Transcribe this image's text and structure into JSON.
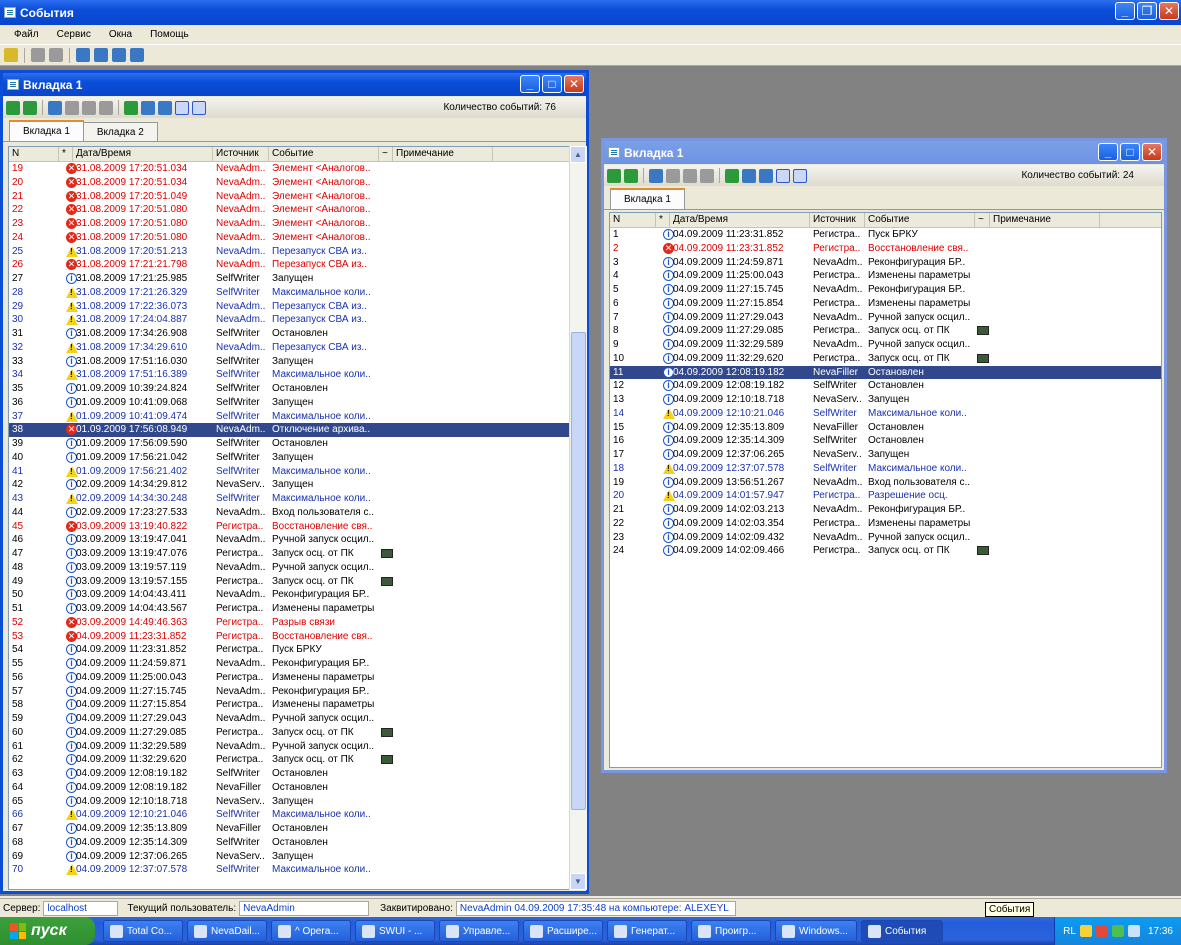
{
  "app": {
    "title": "События"
  },
  "menu": [
    "Файл",
    "Сервис",
    "Окна",
    "Помощь"
  ],
  "left_window": {
    "title": "Вкладка 1",
    "events_count_label": "Количество событий:",
    "events_count": "76",
    "tabs": [
      "Вкладка 1",
      "Вкладка 2"
    ],
    "columns": [
      "N",
      "*",
      "Дата/Время",
      "Источник",
      "Событие",
      "~",
      "Примечание"
    ],
    "rows": [
      {
        "n": "19",
        "sev": "err",
        "dt": "31.08.2009 17:20:51.034",
        "src": "NevaAdm..",
        "ev": "Элемент <Аналогов..",
        "cam": false,
        "color": "red"
      },
      {
        "n": "20",
        "sev": "err",
        "dt": "31.08.2009 17:20:51.034",
        "src": "NevaAdm..",
        "ev": "Элемент <Аналогов..",
        "cam": false,
        "color": "red"
      },
      {
        "n": "21",
        "sev": "err",
        "dt": "31.08.2009 17:20:51.049",
        "src": "NevaAdm..",
        "ev": "Элемент <Аналогов..",
        "cam": false,
        "color": "red"
      },
      {
        "n": "22",
        "sev": "err",
        "dt": "31.08.2009 17:20:51.080",
        "src": "NevaAdm..",
        "ev": "Элемент <Аналогов..",
        "cam": false,
        "color": "red"
      },
      {
        "n": "23",
        "sev": "err",
        "dt": "31.08.2009 17:20:51.080",
        "src": "NevaAdm..",
        "ev": "Элемент <Аналогов..",
        "cam": false,
        "color": "red"
      },
      {
        "n": "24",
        "sev": "err",
        "dt": "31.08.2009 17:20:51.080",
        "src": "NevaAdm..",
        "ev": "Элемент <Аналогов..",
        "cam": false,
        "color": "red"
      },
      {
        "n": "25",
        "sev": "warn",
        "dt": "31.08.2009 17:20:51.213",
        "src": "NevaAdm..",
        "ev": "Перезапуск СВА из..",
        "cam": false,
        "color": "blu"
      },
      {
        "n": "26",
        "sev": "err",
        "dt": "31.08.2009 17:21:21.798",
        "src": "NevaAdm..",
        "ev": "Перезапуск СВА из..",
        "cam": false,
        "color": "red"
      },
      {
        "n": "27",
        "sev": "info",
        "dt": "31.08.2009 17:21:25.985",
        "src": "SelfWriter",
        "ev": "Запущен",
        "cam": false,
        "color": ""
      },
      {
        "n": "28",
        "sev": "warn",
        "dt": "31.08.2009 17:21:26.329",
        "src": "SelfWriter",
        "ev": "Максимальное коли..",
        "cam": false,
        "color": "blu"
      },
      {
        "n": "29",
        "sev": "warn",
        "dt": "31.08.2009 17:22:36.073",
        "src": "NevaAdm..",
        "ev": "Перезапуск СВА из..",
        "cam": false,
        "color": "blu"
      },
      {
        "n": "30",
        "sev": "warn",
        "dt": "31.08.2009 17:24:04.887",
        "src": "NevaAdm..",
        "ev": "Перезапуск СВА из..",
        "cam": false,
        "color": "blu"
      },
      {
        "n": "31",
        "sev": "info",
        "dt": "31.08.2009 17:34:26.908",
        "src": "SelfWriter",
        "ev": "Остановлен",
        "cam": false,
        "color": ""
      },
      {
        "n": "32",
        "sev": "warn",
        "dt": "31.08.2009 17:34:29.610",
        "src": "NevaAdm..",
        "ev": "Перезапуск СВА из..",
        "cam": false,
        "color": "blu"
      },
      {
        "n": "33",
        "sev": "info",
        "dt": "31.08.2009 17:51:16.030",
        "src": "SelfWriter",
        "ev": "Запущен",
        "cam": false,
        "color": ""
      },
      {
        "n": "34",
        "sev": "warn",
        "dt": "31.08.2009 17:51:16.389",
        "src": "SelfWriter",
        "ev": "Максимальное коли..",
        "cam": false,
        "color": "blu"
      },
      {
        "n": "35",
        "sev": "info",
        "dt": "01.09.2009 10:39:24.824",
        "src": "SelfWriter",
        "ev": "Остановлен",
        "cam": false,
        "color": ""
      },
      {
        "n": "36",
        "sev": "info",
        "dt": "01.09.2009 10:41:09.068",
        "src": "SelfWriter",
        "ev": "Запущен",
        "cam": false,
        "color": ""
      },
      {
        "n": "37",
        "sev": "warn",
        "dt": "01.09.2009 10:41:09.474",
        "src": "SelfWriter",
        "ev": "Максимальное коли..",
        "cam": false,
        "color": "blu"
      },
      {
        "n": "38",
        "sev": "err",
        "dt": "01.09.2009 17:56:08.949",
        "src": "NevaAdm..",
        "ev": "Отключение архива..",
        "cam": false,
        "color": "hl"
      },
      {
        "n": "39",
        "sev": "info",
        "dt": "01.09.2009 17:56:09.590",
        "src": "SelfWriter",
        "ev": "Остановлен",
        "cam": false,
        "color": ""
      },
      {
        "n": "40",
        "sev": "info",
        "dt": "01.09.2009 17:56:21.042",
        "src": "SelfWriter",
        "ev": "Запущен",
        "cam": false,
        "color": ""
      },
      {
        "n": "41",
        "sev": "warn",
        "dt": "01.09.2009 17:56:21.402",
        "src": "SelfWriter",
        "ev": "Максимальное коли..",
        "cam": false,
        "color": "blu"
      },
      {
        "n": "42",
        "sev": "info",
        "dt": "02.09.2009 14:34:29.812",
        "src": "NevaServ..",
        "ev": "Запущен",
        "cam": false,
        "color": ""
      },
      {
        "n": "43",
        "sev": "warn",
        "dt": "02.09.2009 14:34:30.248",
        "src": "SelfWriter",
        "ev": "Максимальное коли..",
        "cam": false,
        "color": "blu"
      },
      {
        "n": "44",
        "sev": "info",
        "dt": "02.09.2009 17:23:27.533",
        "src": "NevaAdm..",
        "ev": "Вход пользователя с..",
        "cam": false,
        "color": ""
      },
      {
        "n": "45",
        "sev": "err",
        "dt": "03.09.2009 13:19:40.822",
        "src": "Регистра..",
        "ev": "Восстановление свя..",
        "cam": false,
        "color": "red"
      },
      {
        "n": "46",
        "sev": "info",
        "dt": "03.09.2009 13:19:47.041",
        "src": "NevaAdm..",
        "ev": "Ручной запуск осцил..",
        "cam": false,
        "color": ""
      },
      {
        "n": "47",
        "sev": "info",
        "dt": "03.09.2009 13:19:47.076",
        "src": "Регистра..",
        "ev": "Запуск осц. от ПК",
        "cam": true,
        "color": ""
      },
      {
        "n": "48",
        "sev": "info",
        "dt": "03.09.2009 13:19:57.119",
        "src": "NevaAdm..",
        "ev": "Ручной запуск осцил..",
        "cam": false,
        "color": ""
      },
      {
        "n": "49",
        "sev": "info",
        "dt": "03.09.2009 13:19:57.155",
        "src": "Регистра..",
        "ev": "Запуск осц. от ПК",
        "cam": true,
        "color": ""
      },
      {
        "n": "50",
        "sev": "info",
        "dt": "03.09.2009 14:04:43.411",
        "src": "NevaAdm..",
        "ev": "Реконфигурация БР..",
        "cam": false,
        "color": ""
      },
      {
        "n": "51",
        "sev": "info",
        "dt": "03.09.2009 14:04:43.567",
        "src": "Регистра..",
        "ev": "Изменены параметры",
        "cam": false,
        "color": ""
      },
      {
        "n": "52",
        "sev": "err",
        "dt": "03.09.2009 14:49:46.363",
        "src": "Регистра..",
        "ev": "Разрыв связи",
        "cam": false,
        "color": "red"
      },
      {
        "n": "53",
        "sev": "err",
        "dt": "04.09.2009 11:23:31.852",
        "src": "Регистра..",
        "ev": "Восстановление свя..",
        "cam": false,
        "color": "red"
      },
      {
        "n": "54",
        "sev": "info",
        "dt": "04.09.2009 11:23:31.852",
        "src": "Регистра..",
        "ev": "Пуск БРКУ",
        "cam": false,
        "color": ""
      },
      {
        "n": "55",
        "sev": "info",
        "dt": "04.09.2009 11:24:59.871",
        "src": "NevaAdm..",
        "ev": "Реконфигурация БР..",
        "cam": false,
        "color": ""
      },
      {
        "n": "56",
        "sev": "info",
        "dt": "04.09.2009 11:25:00.043",
        "src": "Регистра..",
        "ev": "Изменены параметры",
        "cam": false,
        "color": ""
      },
      {
        "n": "57",
        "sev": "info",
        "dt": "04.09.2009 11:27:15.745",
        "src": "NevaAdm..",
        "ev": "Реконфигурация БР..",
        "cam": false,
        "color": ""
      },
      {
        "n": "58",
        "sev": "info",
        "dt": "04.09.2009 11:27:15.854",
        "src": "Регистра..",
        "ev": "Изменены параметры",
        "cam": false,
        "color": ""
      },
      {
        "n": "59",
        "sev": "info",
        "dt": "04.09.2009 11:27:29.043",
        "src": "NevaAdm..",
        "ev": "Ручной запуск осцил..",
        "cam": false,
        "color": ""
      },
      {
        "n": "60",
        "sev": "info",
        "dt": "04.09.2009 11:27:29.085",
        "src": "Регистра..",
        "ev": "Запуск осц. от ПК",
        "cam": true,
        "color": ""
      },
      {
        "n": "61",
        "sev": "info",
        "dt": "04.09.2009 11:32:29.589",
        "src": "NevaAdm..",
        "ev": "Ручной запуск осцил..",
        "cam": false,
        "color": ""
      },
      {
        "n": "62",
        "sev": "info",
        "dt": "04.09.2009 11:32:29.620",
        "src": "Регистра..",
        "ev": "Запуск осц. от ПК",
        "cam": true,
        "color": ""
      },
      {
        "n": "63",
        "sev": "info",
        "dt": "04.09.2009 12:08:19.182",
        "src": "SelfWriter",
        "ev": "Остановлен",
        "cam": false,
        "color": ""
      },
      {
        "n": "64",
        "sev": "info",
        "dt": "04.09.2009 12:08:19.182",
        "src": "NevaFiller",
        "ev": "Остановлен",
        "cam": false,
        "color": ""
      },
      {
        "n": "65",
        "sev": "info",
        "dt": "04.09.2009 12:10:18.718",
        "src": "NevaServ..",
        "ev": "Запущен",
        "cam": false,
        "color": ""
      },
      {
        "n": "66",
        "sev": "warn",
        "dt": "04.09.2009 12:10:21.046",
        "src": "SelfWriter",
        "ev": "Максимальное коли..",
        "cam": false,
        "color": "blu"
      },
      {
        "n": "67",
        "sev": "info",
        "dt": "04.09.2009 12:35:13.809",
        "src": "NevaFiller",
        "ev": "Остановлен",
        "cam": false,
        "color": ""
      },
      {
        "n": "68",
        "sev": "info",
        "dt": "04.09.2009 12:35:14.309",
        "src": "SelfWriter",
        "ev": "Остановлен",
        "cam": false,
        "color": ""
      },
      {
        "n": "69",
        "sev": "info",
        "dt": "04.09.2009 12:37:06.265",
        "src": "NevaServ..",
        "ev": "Запущен",
        "cam": false,
        "color": ""
      },
      {
        "n": "70",
        "sev": "warn",
        "dt": "04.09.2009 12:37:07.578",
        "src": "SelfWriter",
        "ev": "Максимальное коли..",
        "cam": false,
        "color": "blu"
      }
    ]
  },
  "right_window": {
    "title": "Вкладка 1",
    "events_count_label": "Количество событий:",
    "events_count": "24",
    "tabs": [
      "Вкладка 1"
    ],
    "columns": [
      "N",
      "*",
      "Дата/Время",
      "Источник",
      "Событие",
      "~",
      "Примечание"
    ],
    "rows": [
      {
        "n": "1",
        "sev": "info",
        "dt": "04.09.2009 11:23:31.852",
        "src": "Регистра..",
        "ev": "Пуск БРКУ",
        "cam": false,
        "color": ""
      },
      {
        "n": "2",
        "sev": "err",
        "dt": "04.09.2009 11:23:31.852",
        "src": "Регистра..",
        "ev": "Восстановление свя..",
        "cam": false,
        "color": "red"
      },
      {
        "n": "3",
        "sev": "info",
        "dt": "04.09.2009 11:24:59.871",
        "src": "NevaAdm..",
        "ev": "Реконфигурация БР..",
        "cam": false,
        "color": ""
      },
      {
        "n": "4",
        "sev": "info",
        "dt": "04.09.2009 11:25:00.043",
        "src": "Регистра..",
        "ev": "Изменены параметры",
        "cam": false,
        "color": ""
      },
      {
        "n": "5",
        "sev": "info",
        "dt": "04.09.2009 11:27:15.745",
        "src": "NevaAdm..",
        "ev": "Реконфигурация БР..",
        "cam": false,
        "color": ""
      },
      {
        "n": "6",
        "sev": "info",
        "dt": "04.09.2009 11:27:15.854",
        "src": "Регистра..",
        "ev": "Изменены параметры",
        "cam": false,
        "color": ""
      },
      {
        "n": "7",
        "sev": "info",
        "dt": "04.09.2009 11:27:29.043",
        "src": "NevaAdm..",
        "ev": "Ручной запуск осцил..",
        "cam": false,
        "color": ""
      },
      {
        "n": "8",
        "sev": "info",
        "dt": "04.09.2009 11:27:29.085",
        "src": "Регистра..",
        "ev": "Запуск осц. от ПК",
        "cam": true,
        "color": ""
      },
      {
        "n": "9",
        "sev": "info",
        "dt": "04.09.2009 11:32:29.589",
        "src": "NevaAdm..",
        "ev": "Ручной запуск осцил..",
        "cam": false,
        "color": ""
      },
      {
        "n": "10",
        "sev": "info",
        "dt": "04.09.2009 11:32:29.620",
        "src": "Регистра..",
        "ev": "Запуск осц. от ПК",
        "cam": true,
        "color": ""
      },
      {
        "n": "11",
        "sev": "info",
        "dt": "04.09.2009 12:08:19.182",
        "src": "NevaFiller",
        "ev": "Остановлен",
        "cam": false,
        "color": "hl"
      },
      {
        "n": "12",
        "sev": "info",
        "dt": "04.09.2009 12:08:19.182",
        "src": "SelfWriter",
        "ev": "Остановлен",
        "cam": false,
        "color": ""
      },
      {
        "n": "13",
        "sev": "info",
        "dt": "04.09.2009 12:10:18.718",
        "src": "NevaServ..",
        "ev": "Запущен",
        "cam": false,
        "color": ""
      },
      {
        "n": "14",
        "sev": "warn",
        "dt": "04.09.2009 12:10:21.046",
        "src": "SelfWriter",
        "ev": "Максимальное коли..",
        "cam": false,
        "color": "blu"
      },
      {
        "n": "15",
        "sev": "info",
        "dt": "04.09.2009 12:35:13.809",
        "src": "NevaFiller",
        "ev": "Остановлен",
        "cam": false,
        "color": ""
      },
      {
        "n": "16",
        "sev": "info",
        "dt": "04.09.2009 12:35:14.309",
        "src": "SelfWriter",
        "ev": "Остановлен",
        "cam": false,
        "color": ""
      },
      {
        "n": "17",
        "sev": "info",
        "dt": "04.09.2009 12:37:06.265",
        "src": "NevaServ..",
        "ev": "Запущен",
        "cam": false,
        "color": ""
      },
      {
        "n": "18",
        "sev": "warn",
        "dt": "04.09.2009 12:37:07.578",
        "src": "SelfWriter",
        "ev": "Максимальное коли..",
        "cam": false,
        "color": "blu"
      },
      {
        "n": "19",
        "sev": "info",
        "dt": "04.09.2009 13:56:51.267",
        "src": "NevaAdm..",
        "ev": "Вход пользователя с..",
        "cam": false,
        "color": ""
      },
      {
        "n": "20",
        "sev": "warn",
        "dt": "04.09.2009 14:01:57.947",
        "src": "Регистра..",
        "ev": "Разрешение осц.",
        "cam": false,
        "color": "blu"
      },
      {
        "n": "21",
        "sev": "info",
        "dt": "04.09.2009 14:02:03.213",
        "src": "NevaAdm..",
        "ev": "Реконфигурация БР..",
        "cam": false,
        "color": ""
      },
      {
        "n": "22",
        "sev": "info",
        "dt": "04.09.2009 14:02:03.354",
        "src": "Регистра..",
        "ev": "Изменены параметры",
        "cam": false,
        "color": ""
      },
      {
        "n": "23",
        "sev": "info",
        "dt": "04.09.2009 14:02:09.432",
        "src": "NevaAdm..",
        "ev": "Ручной запуск осцил..",
        "cam": false,
        "color": ""
      },
      {
        "n": "24",
        "sev": "info",
        "dt": "04.09.2009 14:02:09.466",
        "src": "Регистра..",
        "ev": "Запуск осц. от ПК",
        "cam": true,
        "color": ""
      }
    ]
  },
  "status": {
    "server_label": "Сервер:",
    "server": "localhost",
    "user_label": "Текущий пользователь:",
    "user": "NevaAdmin",
    "ack_label": "Заквитировано:",
    "ack": "NevaAdmin  04.09.2009 17:35:48  на компьютере: ALEXEYL"
  },
  "tooltip": "События",
  "taskbar": {
    "start": "пуск",
    "buttons": [
      "Total Co...",
      "NevaDail...",
      "^ Opera...",
      "SWUI - ...",
      "Управле...",
      "Расшире...",
      "Генерат...",
      "Проигр...",
      "Windows...",
      "События"
    ],
    "lang": "RL",
    "clock": "17:36"
  },
  "colors": {
    "red_text": "#e00000",
    "blue_text": "#1a32b0",
    "highlight": "#31498c"
  }
}
